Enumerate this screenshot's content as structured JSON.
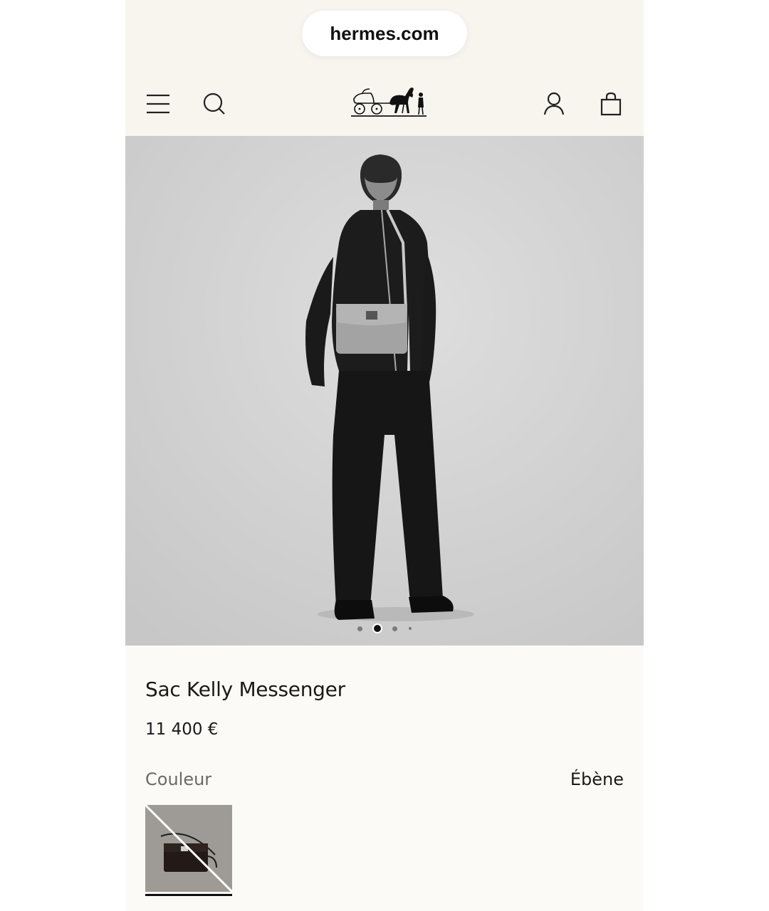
{
  "browser": {
    "url": "hermes.com"
  },
  "header": {
    "menu_icon": "menu-icon",
    "search_icon": "search-icon",
    "logo_icon": "hermes-carriage-logo",
    "account_icon": "user-icon",
    "cart_icon": "shopping-bag-icon"
  },
  "gallery": {
    "image_count": 4,
    "active_index": 1
  },
  "product": {
    "name": "Sac Kelly Messenger",
    "price": "11 400 €",
    "color_label": "Couleur",
    "color_value": "Ébène",
    "swatches": [
      {
        "name": "Ébène",
        "selected": true,
        "unavailable": true
      }
    ]
  }
}
